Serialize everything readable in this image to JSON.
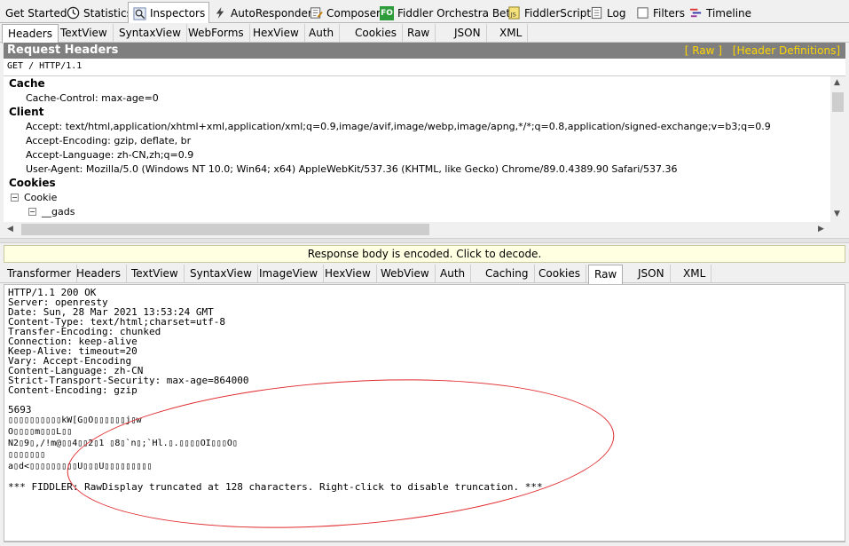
{
  "top_tabs": [
    {
      "label": "Get Started",
      "icon": "none"
    },
    {
      "label": "Statistics",
      "icon": "clock-icon"
    },
    {
      "label": "Inspectors",
      "icon": "inspector-icon"
    },
    {
      "label": "AutoResponder",
      "icon": "lightning-icon"
    },
    {
      "label": "Composer",
      "icon": "composer-icon"
    },
    {
      "label": "Fiddler Orchestra Beta",
      "icon": "fo-icon"
    },
    {
      "label": "FiddlerScript",
      "icon": "script-icon"
    },
    {
      "label": "Log",
      "icon": "log-icon"
    },
    {
      "label": "Filters",
      "icon": "checkbox-icon"
    },
    {
      "label": "Timeline",
      "icon": "timeline-icon"
    }
  ],
  "fo_badge": "FO",
  "request_tabs": [
    "Headers",
    "TextView",
    "SyntaxView",
    "WebForms",
    "HexView",
    "Auth",
    "Cookies",
    "Raw",
    "JSON",
    "XML"
  ],
  "request": {
    "title": "Request Headers",
    "raw_link": "[ Raw ]",
    "defs_link": "[Header Definitions]",
    "request_line": "GET / HTTP/1.1",
    "cache_group": "Cache",
    "cache_control": "Cache-Control: max-age=0",
    "client_group": "Client",
    "accept": "Accept: text/html,application/xhtml+xml,application/xml;q=0.9,image/avif,image/webp,image/apng,*/*;q=0.8,application/signed-exchange;v=b3;q=0.9",
    "accept_encoding": "Accept-Encoding: gzip, deflate, br",
    "accept_language": "Accept-Language: zh-CN,zh;q=0.9",
    "user_agent": "User-Agent: Mozilla/5.0 (Windows NT 10.0; Win64; x64) AppleWebKit/537.36 (KHTML, like Gecko) Chrome/89.0.4389.90 Safari/537.36",
    "cookies_group": "Cookies",
    "cookie_node": "Cookie",
    "gads_node": "__gads",
    "minus": "−"
  },
  "encoded_notice": "Response body is encoded. Click to decode.",
  "response_tabs": [
    "Transformer",
    "Headers",
    "TextView",
    "SyntaxView",
    "ImageView",
    "HexView",
    "WebView",
    "Auth",
    "Caching",
    "Cookies",
    "Raw",
    "JSON",
    "XML"
  ],
  "response": {
    "headers": [
      "HTTP/1.1 200 OK",
      "Server: openresty",
      "Date: Sun, 28 Mar 2021 13:53:24 GMT",
      "Content-Type: text/html;charset=utf-8",
      "Transfer-Encoding: chunked",
      "Connection: keep-alive",
      "Keep-Alive: timeout=20",
      "Vary: Accept-Encoding",
      "Content-Language: zh-CN",
      "Strict-Transport-Security: max-age=864000",
      "Content-Encoding: gzip"
    ],
    "chunk_size": "5693",
    "body_lines": [
      "▯▯▯▯▯▯▯▯▯▯kW[G▯O▯▯▯▯▯▯j▯w",
      "O▯▯▯▯m▯▯▯L▯▯",
      "N2▯9▯,/!m@▯▯4▯▯2▯1 ▯8▯`n▯;`Hl.▯.▯▯▯▯OI▯▯▯O▯",
      "▯▯▯▯▯▯▯",
      "a▯d<▯▯▯▯▯▯▯▯▯U▯▯▯U▯▯▯▯▯▯▯▯▯"
    ],
    "truncation_note": "*** FIDDLER: RawDisplay truncated at 128 characters. Right-click to disable truncation. ***"
  }
}
